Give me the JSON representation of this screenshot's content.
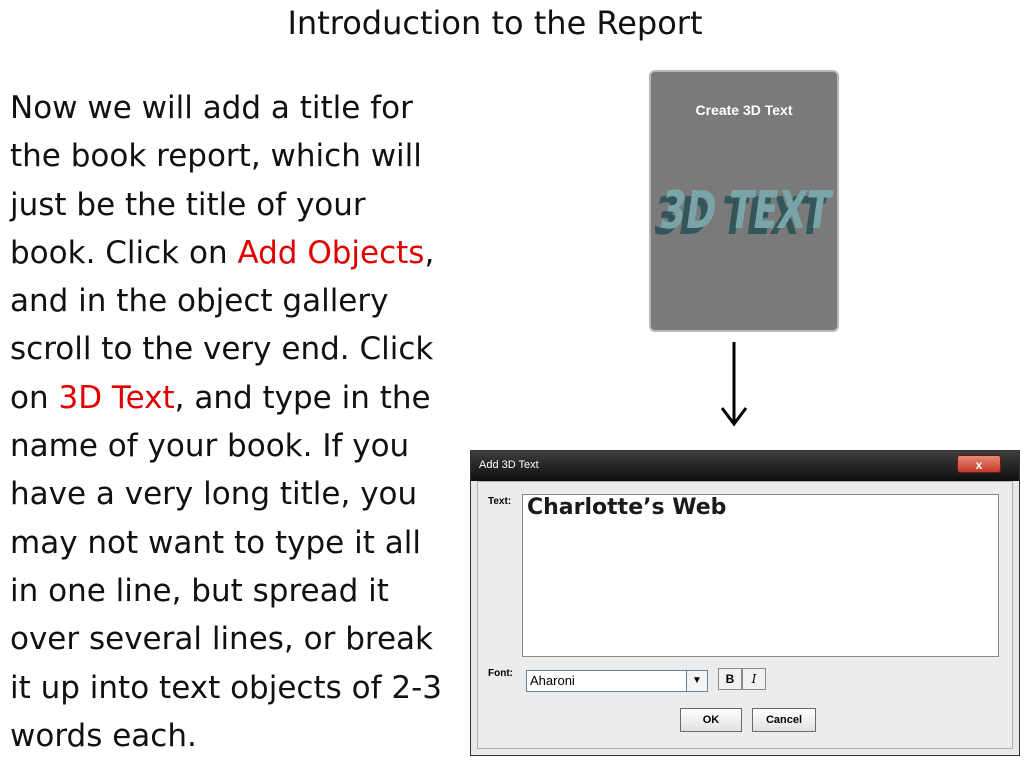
{
  "slide": {
    "title": "Introduction to the Report"
  },
  "body": {
    "lines": [
      "Now we will add a title for",
      "the book report, which will",
      "just be the title of your"
    ],
    "line4_before": "book. Click on ",
    "line4_highlight": "Add Objects",
    "line4_after": ",",
    "line5": "and in the object gallery",
    "line6": "scroll to the very end. Click",
    "line7_before": "on ",
    "line7_highlight": "3D Text",
    "line7_after": ", and type in the",
    "more_lines": [
      "name of your book. If you",
      "have a very long title, you",
      "may not want to type it all",
      "in one line, but spread it",
      "over several lines, or break",
      "it up into text objects of 2-3",
      "words each."
    ],
    "highlight_color": "#e00000"
  },
  "gallery_tile": {
    "label": "Create 3D Text",
    "art_text": "3D TEXT"
  },
  "dialog": {
    "title": "Add 3D Text",
    "close_symbol": "x",
    "text_label": "Text:",
    "text_value": "Charlotte’s Web",
    "font_label": "Font:",
    "font_value": "Aharoni",
    "bold_label": "B",
    "italic_label": "I",
    "ok_label": "OK",
    "cancel_label": "Cancel"
  }
}
